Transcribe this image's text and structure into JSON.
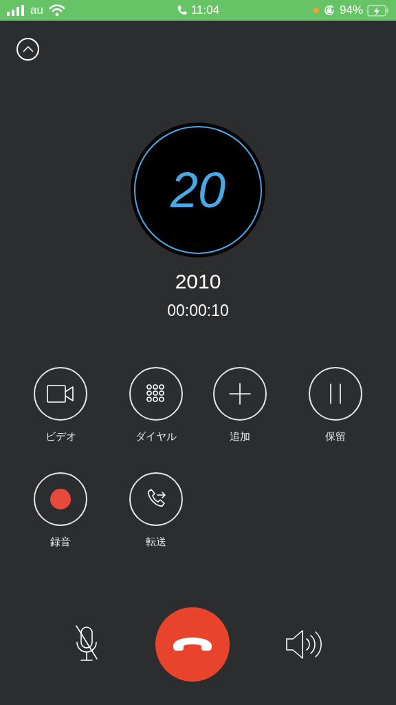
{
  "status_bar": {
    "carrier": "au",
    "time": "11:04",
    "battery": "94%"
  },
  "avatar": {
    "text": "20"
  },
  "caller": {
    "name": "2010",
    "duration": "00:00:10"
  },
  "actions": [
    {
      "kind": "video",
      "label": "ビデオ"
    },
    {
      "kind": "dialpad",
      "label": "ダイヤル"
    },
    {
      "kind": "add",
      "label": "追加"
    },
    {
      "kind": "hold",
      "label": "保留"
    },
    {
      "kind": "record",
      "label": "録音"
    },
    {
      "kind": "transfer",
      "label": "転送"
    }
  ],
  "mic": {
    "muted": true
  }
}
